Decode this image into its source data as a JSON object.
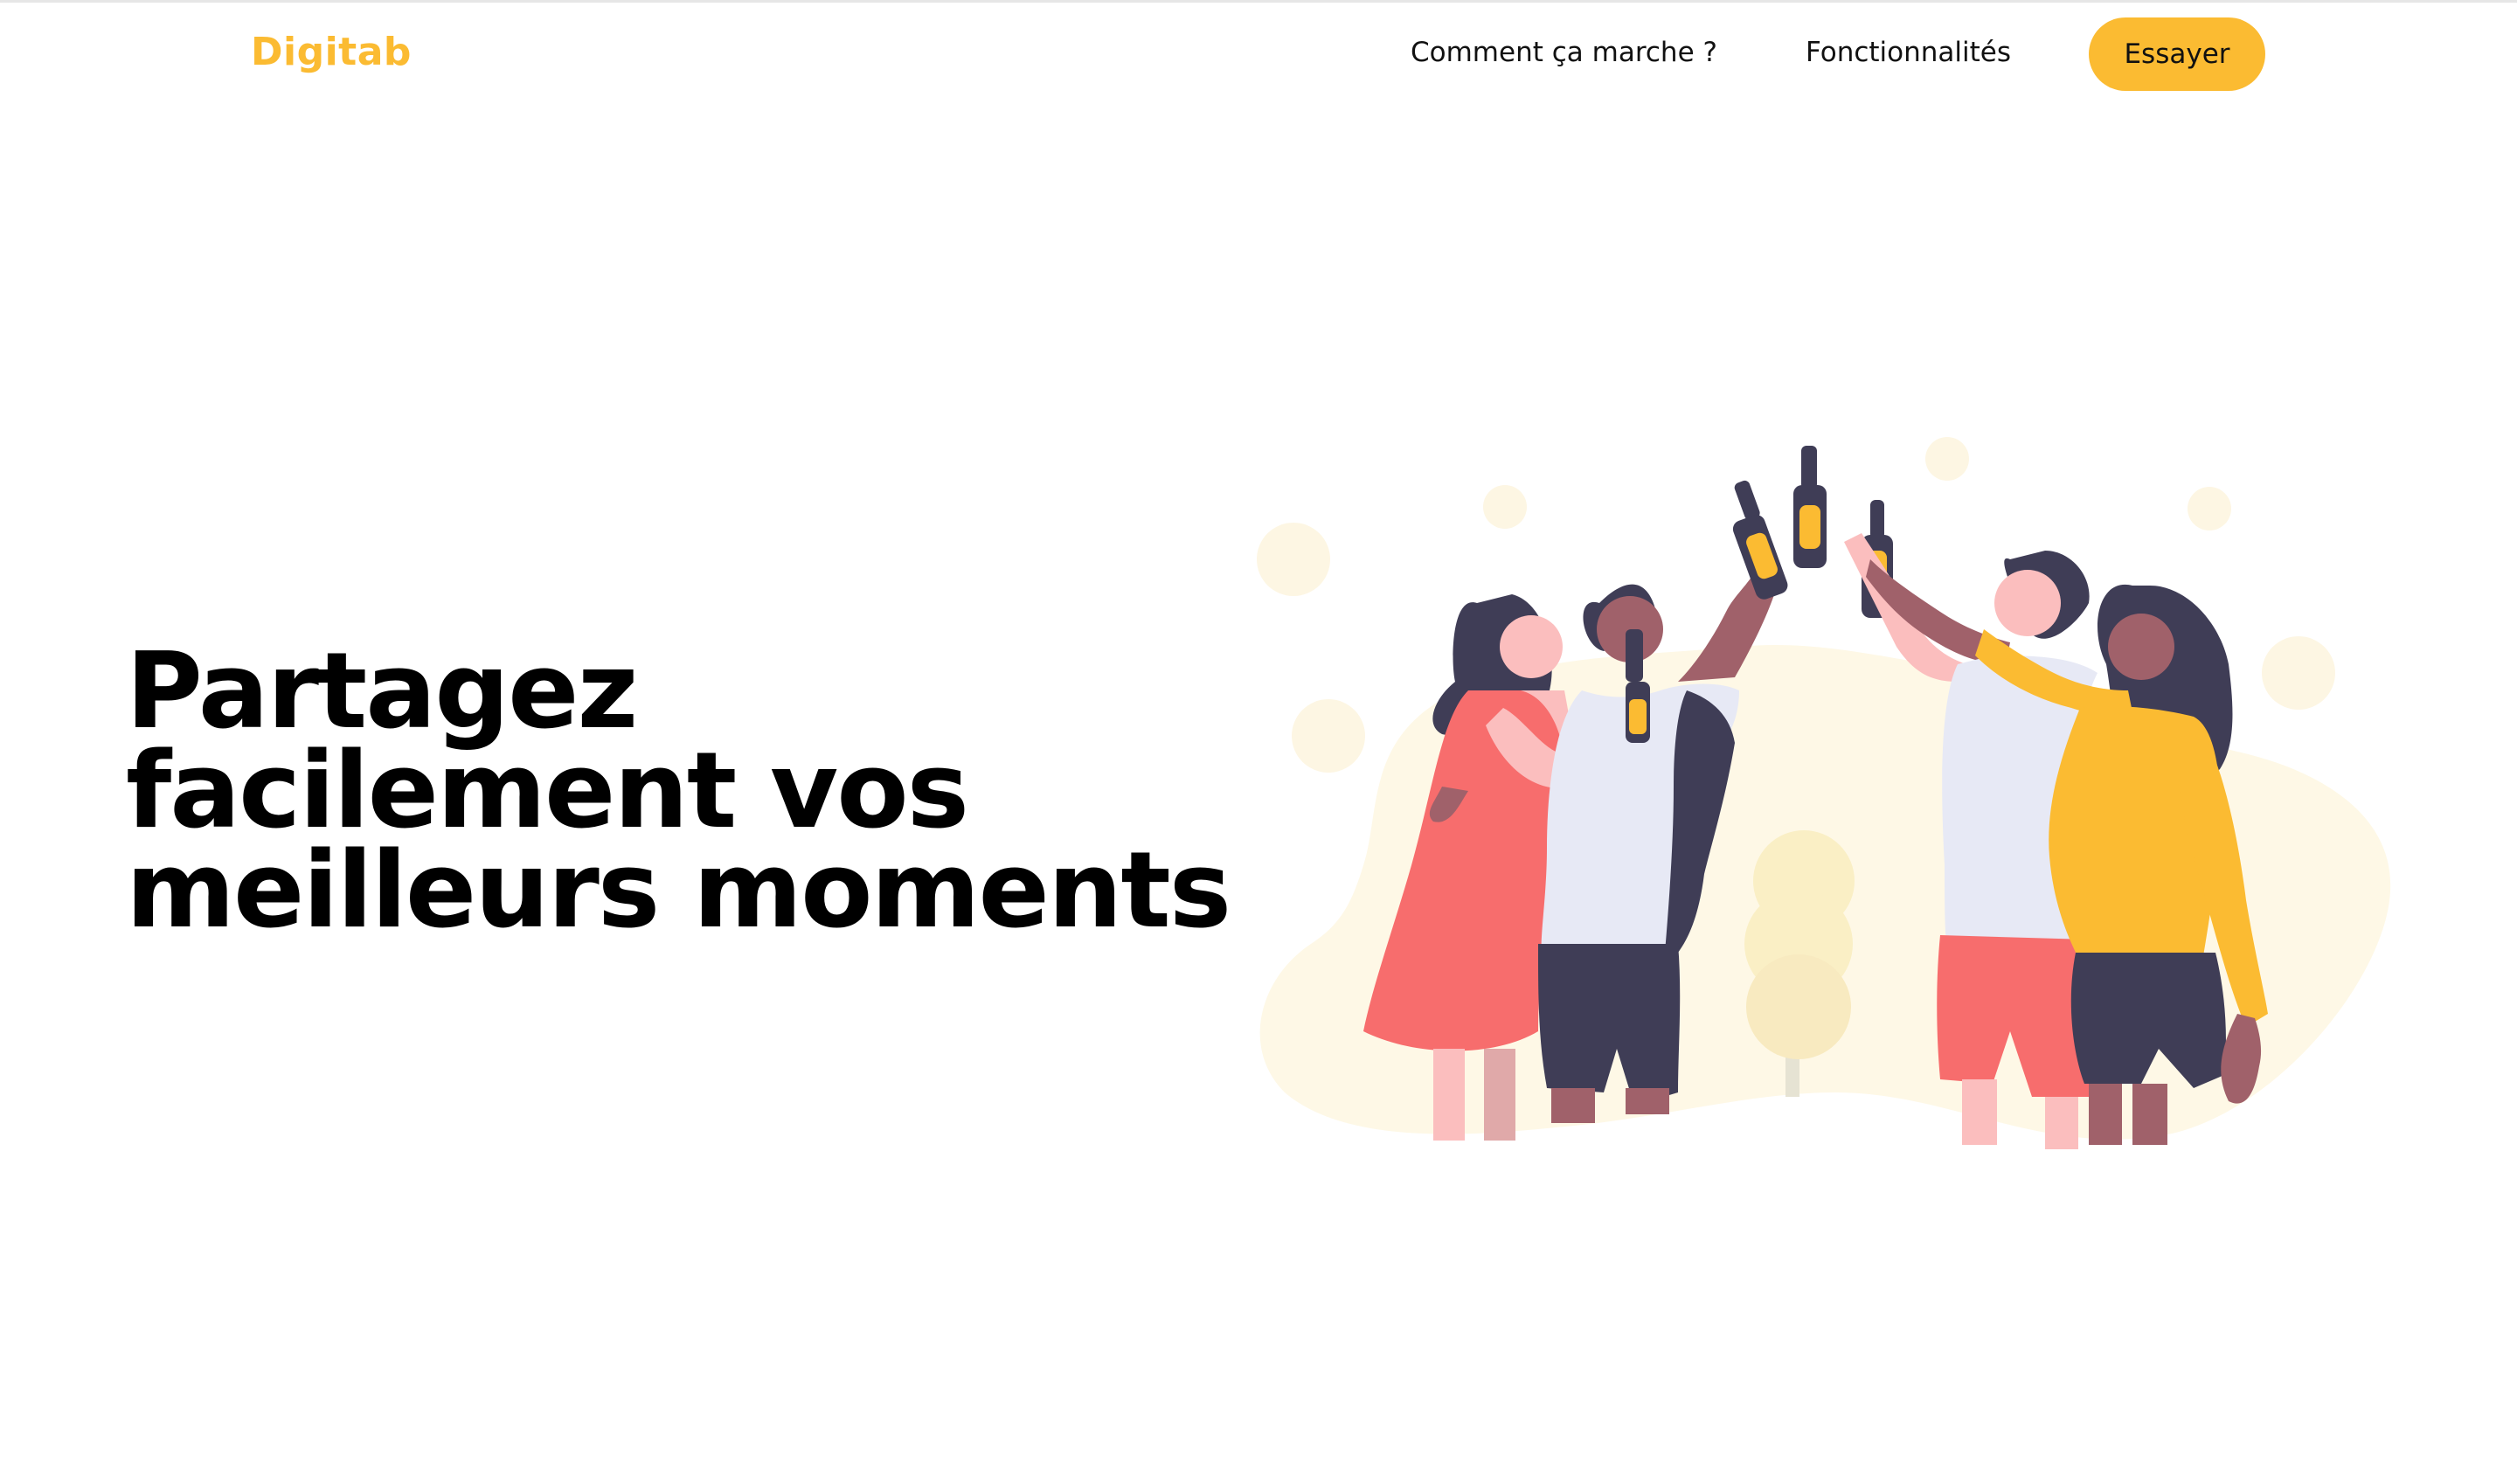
{
  "header": {
    "logo": "Digitab",
    "nav": [
      {
        "label": "Comment ça marche ?"
      },
      {
        "label": "Fonctionnalités"
      }
    ],
    "cta_label": "Essayer"
  },
  "hero": {
    "title_lines": [
      "Partagez",
      "facilement vos",
      "meilleurs moments"
    ]
  },
  "colors": {
    "accent": "#fbbb32",
    "text": "#000000",
    "background": "#ffffff",
    "coral": "#f76d6d",
    "navy": "#3f3d56",
    "pale": "#fef8e6"
  },
  "illustration": {
    "subject": "friends-toasting-bottles-icon"
  }
}
